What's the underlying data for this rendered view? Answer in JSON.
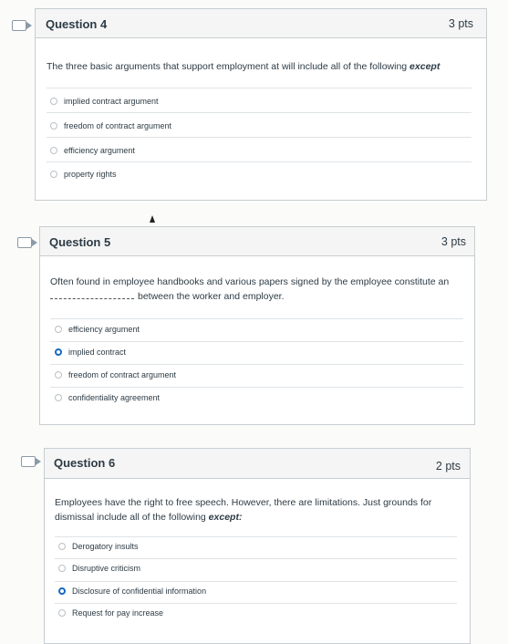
{
  "q4": {
    "title": "Question 4",
    "points": "3 pts",
    "prompt_main": "The three basic arguments that support employment at will include all of the following ",
    "prompt_em": "except",
    "answers": [
      "implied contract argument",
      "freedom of contract argument",
      "efficiency argument",
      "property rights"
    ],
    "selected_index": null
  },
  "q5": {
    "title": "Question 5",
    "points": "3 pts",
    "prompt_line1": "Often found in employee handbooks and various papers signed by the employee constitute an",
    "prompt_line2": "between the worker and employer.",
    "answers": [
      "efficiency argument",
      "implied contract",
      "freedom of contract argument",
      "confidentiality agreement"
    ],
    "selected_index": 1
  },
  "q6": {
    "title": "Question 6",
    "points": "2 pts",
    "prompt_line1": "Employees have the right to free speech. However, there are limitations. Just grounds for",
    "prompt_line2": "dismissal include all of the following ",
    "prompt_em": "except:",
    "answers": [
      "Derogatory insults",
      "Disruptive criticism",
      "Disclosure of confidential information",
      "Request for pay increase"
    ],
    "selected_index": 2
  },
  "colors": {
    "selected": "#1769c4",
    "border": "#c7cdd1",
    "text": "#2d3b45"
  }
}
